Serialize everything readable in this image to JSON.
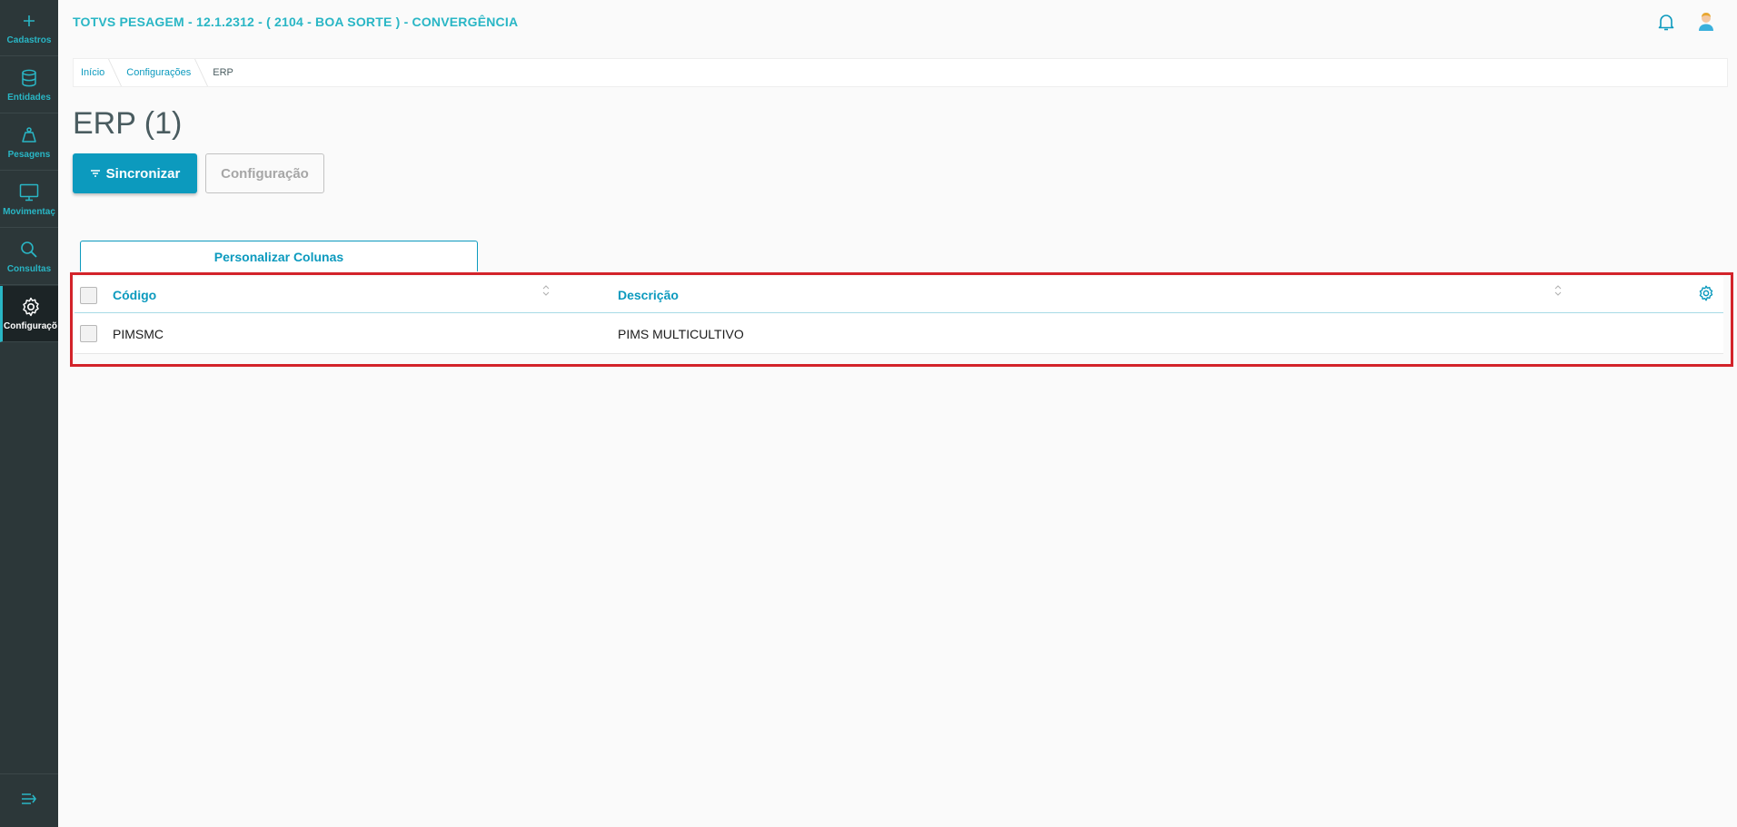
{
  "header": {
    "app_title": "TOTVS PESAGEM - 12.1.2312 - ( 2104 - BOA SORTE ) - CONVERGÊNCIA"
  },
  "sidebar": {
    "items": [
      {
        "label": "Cadastros",
        "icon": "plus-icon"
      },
      {
        "label": "Entidades",
        "icon": "database-icon"
      },
      {
        "label": "Pesagens",
        "icon": "scale-icon"
      },
      {
        "label": "Movimentaç",
        "icon": "monitor-icon"
      },
      {
        "label": "Consultas",
        "icon": "search-icon"
      },
      {
        "label": "Configuraçõ",
        "icon": "gear-icon",
        "active": true
      }
    ],
    "collapse_icon": "collapse-menu-icon"
  },
  "breadcrumb": [
    {
      "label": "Início"
    },
    {
      "label": "Configurações"
    },
    {
      "label": "ERP"
    }
  ],
  "page": {
    "title": "ERP (1)"
  },
  "actions": {
    "sync_label": "Sincronizar",
    "config_label": "Configuração"
  },
  "table": {
    "customize_label": "Personalizar Colunas",
    "columns": [
      "Código",
      "Descrição"
    ],
    "rows": [
      {
        "codigo": "PIMSMC",
        "descricao": "PIMS MULTICULTIVO"
      }
    ]
  },
  "colors": {
    "accent": "#0c9abe",
    "sidebar_bg": "#2c3739",
    "highlight": "#d3232a"
  }
}
